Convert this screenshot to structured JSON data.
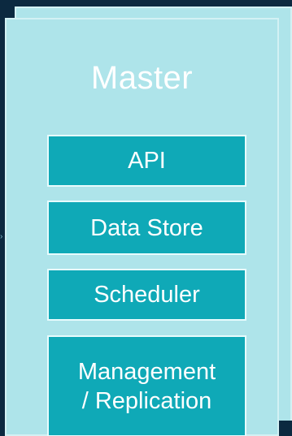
{
  "panel": {
    "title": "Master"
  },
  "components": {
    "api": "API",
    "data_store": "Data Store",
    "scheduler": "Scheduler",
    "management_line1": "Management",
    "management_line2": "/ Replication"
  },
  "colors": {
    "background": "#0c2940",
    "panel": "#aee4ea",
    "component": "#0fa9b7",
    "text": "#ffffff"
  }
}
